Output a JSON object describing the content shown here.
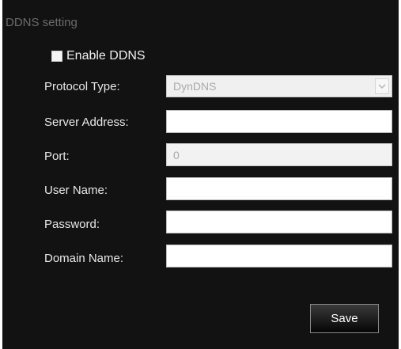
{
  "section": {
    "title": "DDNS setting"
  },
  "enable_ddns": {
    "label": "Enable DDNS",
    "checked": false
  },
  "fields": {
    "protocol_type": {
      "label": "Protocol Type:",
      "value": "DynDNS",
      "enabled": false
    },
    "server_address": {
      "label": "Server Address:",
      "value": ""
    },
    "port": {
      "label": "Port:",
      "value": "0",
      "enabled": false
    },
    "user_name": {
      "label": "User Name:",
      "value": ""
    },
    "password": {
      "label": "Password:",
      "value": ""
    },
    "domain_name": {
      "label": "Domain Name:",
      "value": ""
    }
  },
  "actions": {
    "save_label": "Save"
  },
  "icons": {
    "dropdown": "chevron-down-icon",
    "checkbox": "checkbox-icon"
  },
  "colors": {
    "panel_bg": "#121212",
    "title_text": "#6b6b6b",
    "label_text": "#e8e8e8"
  }
}
